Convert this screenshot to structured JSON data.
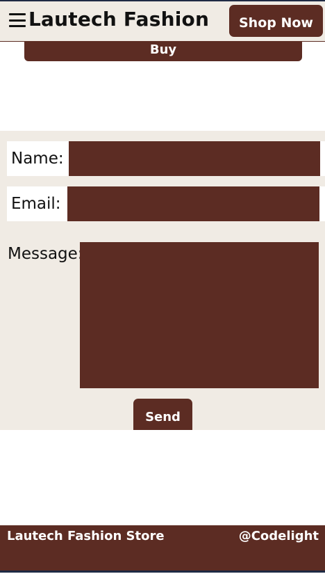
{
  "header": {
    "brand": "Lautech Fashion",
    "shop_now_label": "Shop Now"
  },
  "product": {
    "buy_label": "Buy"
  },
  "contact_form": {
    "name_label": "Name:",
    "email_label": "Email:",
    "message_label": "Message:",
    "name_value": "",
    "email_value": "",
    "message_value": "",
    "send_label": "Send"
  },
  "footer": {
    "store_name": "Lautech Fashion Store",
    "credit": "@Codelight"
  },
  "colors": {
    "accent": "#5c2c23",
    "panel": "#f0ebe4"
  }
}
